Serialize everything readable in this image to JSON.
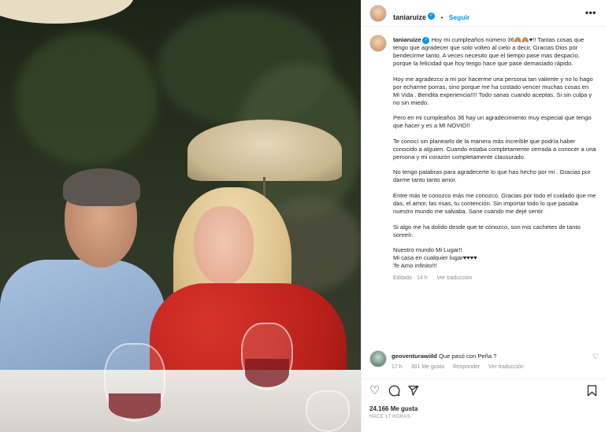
{
  "post": {
    "username": "taniaruize",
    "follow_label": "Seguir",
    "more_label": "•••"
  },
  "caption": {
    "username": "taniaruize",
    "paragraphs": [
      "Hoy mi cumpleaños número 36🙈🙈♥!! Tantas cosas que tengo que agradecer que solo volteo al cielo a decir, Gracias Dios por bendecirme tanto. A veces necesito que el tiempo pase mas despacio, porque la felicidad que hoy tengo hace que pase demasiado rápido.",
      "Hoy me agradezco a mi por hacerme una persona tan valiente y no lo hago por echarme porras, sino porque me ha costado vencer muchas cosas en Mi Vida . Bendita experiencia!!!! Todo sanas cuando aceptas. Si sin culpa y no sin miedo.",
      "Pero en mi cumpleaños 36 hay un agradecimiento muy especial que tengo que hacer y es a MI NOVIO!!",
      "Te conocí sin planearlo de la manera más increíble que podría haber conocido a alguien. Cuando estaba completamente cerrada a conocer a una persona y mi corazón completamente clausurado.",
      "No tengo palabras para agradecerte lo que has hecho por mi . Gracias por darme tanto tanto amor.",
      "Entre más te conozco más me conozco. Gracias por todo el cuidado que me das, el amor, las risas, tu contención. Sin importar todo lo que pasaba nuestro mundo me salvaba. Sane cuando me dejé sentir.",
      "Si algo me ha dolido desde que te conozco, son mis cachetes de tanto sonreír.",
      "Nuestro mundo Mi Lugar!!\nMi casa en cualquier lugar♥♥♥♥\nTe Amo infinito!!!"
    ],
    "edited_label": "Editado",
    "time": "14 h",
    "translate_label": "Ver traducción"
  },
  "comment": {
    "username": "geoventurawiild",
    "text": "Que pasó con Peña ?",
    "time": "17 h",
    "likes": "301 Me gusta",
    "reply_label": "Responder",
    "translate_label": "Ver traducción"
  },
  "footer": {
    "likes": "24.166 Me gusta",
    "time_ago": "HACE 17 HORAS"
  },
  "icons": {
    "like": "heart-icon",
    "comment": "comment-icon",
    "share": "share-icon",
    "save": "bookmark-icon"
  },
  "colors": {
    "accent": "#0095f6",
    "text": "#262626",
    "muted": "#8e8e8e",
    "verified": "#0095f6"
  }
}
